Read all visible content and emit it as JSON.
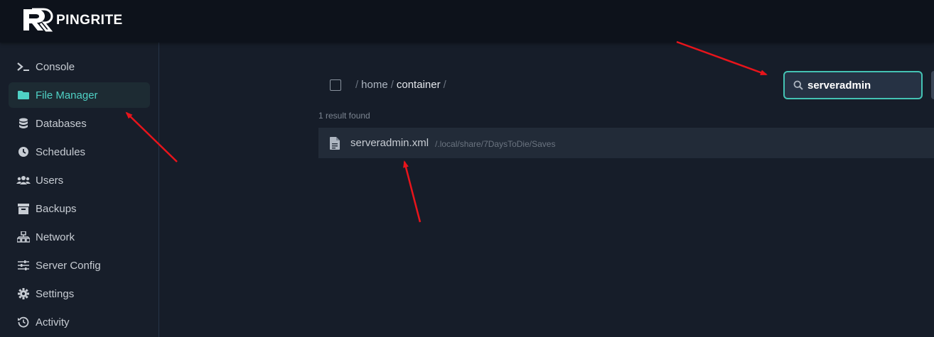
{
  "brand": {
    "name": "PINGRITE",
    "icon": "pr-logo-icon"
  },
  "sidebar": {
    "items": [
      {
        "label": "Console",
        "icon": "terminal-icon"
      },
      {
        "label": "File Manager",
        "icon": "folder-icon",
        "active": true
      },
      {
        "label": "Databases",
        "icon": "database-icon"
      },
      {
        "label": "Schedules",
        "icon": "clock-icon"
      },
      {
        "label": "Users",
        "icon": "users-icon"
      },
      {
        "label": "Backups",
        "icon": "archive-icon"
      },
      {
        "label": "Network",
        "icon": "network-icon"
      },
      {
        "label": "Server Config",
        "icon": "sliders-icon"
      },
      {
        "label": "Settings",
        "icon": "gear-icon"
      },
      {
        "label": "Activity",
        "icon": "history-icon"
      }
    ]
  },
  "breadcrumb": {
    "sep": "/",
    "home": "home",
    "current": "container"
  },
  "search": {
    "value": "serveradmin",
    "icon": "search-icon"
  },
  "results": {
    "count_text": "1 result found",
    "items": [
      {
        "name": "serveradmin.xml",
        "path": "/.local/share/7DaysToDie/Saves",
        "icon": "file-icon"
      }
    ]
  },
  "colors": {
    "accent": "#4fd1c5",
    "topbar": "#0d121b",
    "background": "#161d29",
    "annotation_arrow": "#e8141b"
  }
}
